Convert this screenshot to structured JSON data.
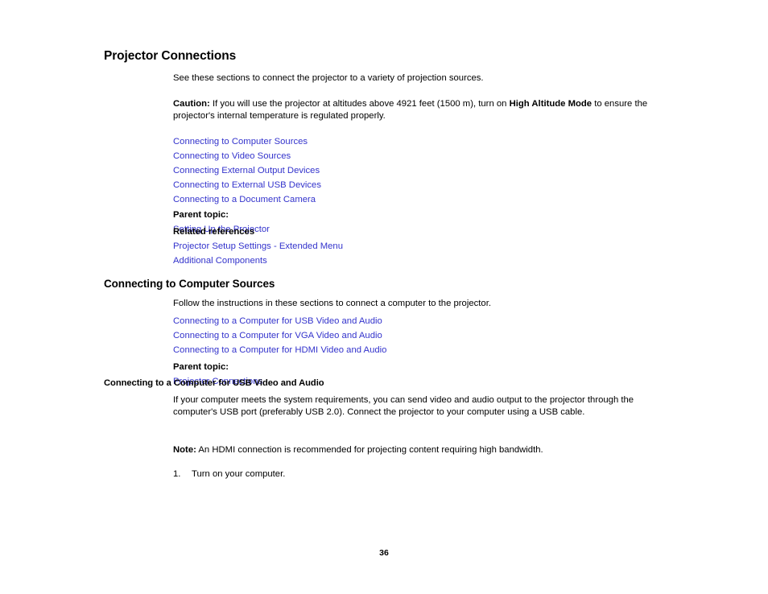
{
  "document": {
    "page_number": "36",
    "link_color": "#3333cc",
    "text_color": "#000000",
    "background_color": "#ffffff"
  },
  "title": "Projector Connections",
  "intro": "See these sections to connect the projector to a variety of projection sources.",
  "caution": {
    "label": "Caution:",
    "text_before_bold": " If you will use the projector at altitudes above 4921 feet (1500 m), turn on ",
    "bold_term": "High Altitude Mode",
    "text_after_bold": " to ensure the projector's internal temperature is regulated properly."
  },
  "topic_links": [
    "Connecting to Computer Sources",
    "Connecting to Video Sources",
    "Connecting External Output Devices",
    "Connecting to External USB Devices",
    "Connecting to a Document Camera"
  ],
  "parent_topic_1": {
    "label": "Parent topic:",
    "link": "Setting Up the Projector"
  },
  "related_references": {
    "heading": "Related references",
    "links": [
      "Projector Setup Settings - Extended Menu",
      "Additional Components"
    ]
  },
  "section_computer_sources": {
    "title": "Connecting to Computer Sources",
    "intro": "Follow the instructions in these sections to connect a computer to the projector.",
    "links": [
      "Connecting to a Computer for USB Video and Audio",
      "Connecting to a Computer for VGA Video and Audio",
      "Connecting to a Computer for HDMI Video and Audio"
    ],
    "parent_topic": {
      "label": "Parent topic:",
      "link": "Projector Connections"
    }
  },
  "subsection_usb": {
    "title": "Connecting to a Computer for USB Video and Audio",
    "paragraph": "If your computer meets the system requirements, you can send video and audio output to the projector through the computer's USB port (preferably USB 2.0). Connect the projector to your computer using a USB cable.",
    "note": {
      "label": "Note:",
      "text": " An HDMI connection is recommended for projecting content requiring high bandwidth."
    },
    "steps": [
      {
        "number": "1.",
        "text": "Turn on your computer."
      }
    ]
  }
}
